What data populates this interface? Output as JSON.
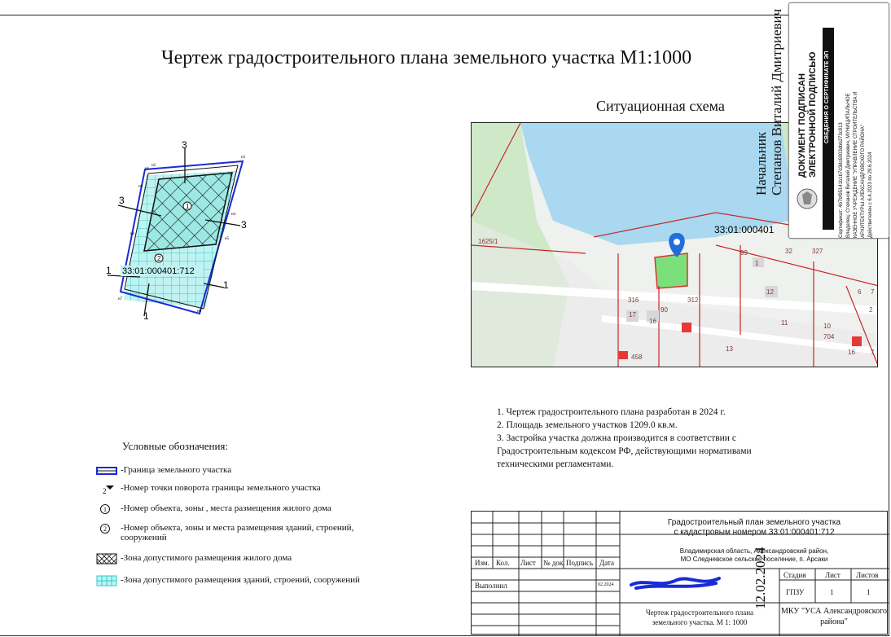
{
  "header": {
    "title": "Чертеж  градостроительного плана земельного участка М1:1000",
    "subtitle": "Ситуационная схема"
  },
  "plan": {
    "cadastral": "33:01:000401:712",
    "section_marks": [
      "3",
      "3",
      "3",
      "1",
      "1",
      "1"
    ],
    "zone_numbers": [
      "1",
      "2"
    ],
    "point_labels": [
      "н1",
      "н2",
      "н3",
      "н4",
      "н5",
      "н6",
      "н7",
      "н8",
      "н9"
    ]
  },
  "map": {
    "parcel_label": "33:01:000401",
    "labels": [
      "1625/1",
      "99",
      "1",
      "32",
      "327",
      "316",
      "90",
      "312",
      "17",
      "16",
      "12",
      "11",
      "13",
      "458",
      "704",
      "10",
      "16",
      "6",
      "7",
      "2",
      "7"
    ]
  },
  "signature_block": {
    "position": "Начальник",
    "name": "Степанов Виталий Дмитриевич",
    "date": "12.02.2024"
  },
  "e_sign": {
    "line1": "ДОКУМЕНТ ПОДПИСАН",
    "line2": "ЭЛЕКТРОННОЙ ПОДПИСЬЮ",
    "line3": "СВЕДЕНИЯ О СЕРТИФИКАТЕ ЭП",
    "cert": "Сертификат: 4b7bf95141b1b7d3dc6003dbb273c913",
    "owner": "Владелец: Степанов Виталий Дмитриевич, МУНИЦИПАЛЬНОЕ",
    "org1": "КАЗЕННОЕ УЧРЕЖДЕНИЕ \"УПРАВЛЕНИЕ СТРОИТЕЛЬСТВА И",
    "org2": "АРХИТЕКТУРЫ АЛЕКСАНДРОВСКОГО РАЙОНА\"",
    "valid": "Действителен с 6.4.2023 по 29.6.2024"
  },
  "legend": {
    "title": "Условные обозначения:",
    "items": [
      "-Граница земельного участка",
      "-Номер точки поворота границы земельного участка",
      "-Номер объекта, зоны , места размещения жилого дома",
      "-Номер объекта, зоны и места размещения зданий, строений, сооружений",
      "-Зона допустимого размещения жилого дома",
      "-Зона допустимого размещения зданий, строений, сооружений"
    ],
    "icon_labels": [
      "2",
      "1",
      "2"
    ]
  },
  "notes": [
    "1. Чертеж градостроительного плана разработан в 2024 г.",
    "2. Площадь земельного участков 1209.0 кв.м.",
    "3. Застройка участка должна производится в соответствии с",
    "Градостроительным кодексом РФ, действующими нормативами",
    "техническими регламентами."
  ],
  "stamp": {
    "headers": [
      "Изм.",
      "Кол.",
      "Лист",
      "№ док.",
      "Подпись",
      "Дата"
    ],
    "performed": "Выполнил",
    "performed_date": "02.2024",
    "doc_title_1": "Градостроительный план земельного участка",
    "doc_title_2": "с кадастровым номером 33:01:000401:712",
    "address_1": "Владимирская область, Александровский район,",
    "address_2": "МО Следневское сельское поселение, п. Арсаки",
    "stage_h": "Стадия",
    "sheet_h": "Лист",
    "sheets_h": "Листов",
    "stage": "ГПЗУ",
    "sheet": "1",
    "sheets": "1",
    "drawing_1": "Чертеж градостроительного плана",
    "drawing_2": "земельного участка. М 1: 1000",
    "org_1": "МКУ \"УСА Александровского",
    "org_2": "района\""
  }
}
